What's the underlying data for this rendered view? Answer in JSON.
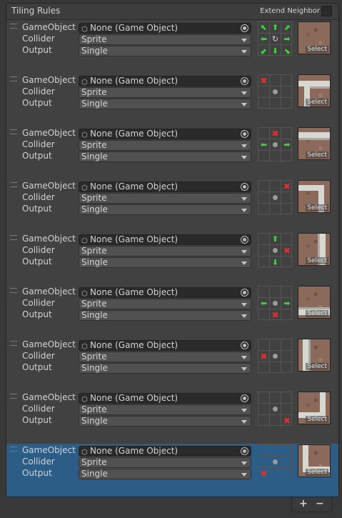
{
  "panel": {
    "title": "Tiling Rules",
    "extend_neighbor_label": "Extend Neighbor"
  },
  "labels": {
    "gameobject": "GameObject",
    "collider": "Collider",
    "output": "Output"
  },
  "rules": [
    {
      "gameobject": "None (Game Object)",
      "collider": "Sprite",
      "output": "Single",
      "sprite_button": "Select",
      "selected": false,
      "neighbors": [
        "arrow-up-left",
        "arrow-up",
        "arrow-up-right",
        "arrow-left",
        "rotate",
        "arrow-right",
        "arrow-down-left",
        "arrow-down",
        "arrow-down-right"
      ]
    },
    {
      "gameobject": "None (Game Object)",
      "collider": "Sprite",
      "output": "Single",
      "sprite_button": "Select",
      "selected": false,
      "neighbors": [
        "x",
        "",
        "",
        "",
        "dot",
        "",
        "",
        "",
        ""
      ]
    },
    {
      "gameobject": "None (Game Object)",
      "collider": "Sprite",
      "output": "Single",
      "sprite_button": "Select",
      "selected": false,
      "neighbors": [
        "",
        "x",
        "",
        "arrow-left",
        "dot",
        "arrow-right",
        "",
        "",
        ""
      ]
    },
    {
      "gameobject": "None (Game Object)",
      "collider": "Sprite",
      "output": "Single",
      "sprite_button": "Select",
      "selected": false,
      "neighbors": [
        "",
        "",
        "x",
        "",
        "dot",
        "",
        "",
        "",
        ""
      ]
    },
    {
      "gameobject": "None (Game Object)",
      "collider": "Sprite",
      "output": "Single",
      "sprite_button": "Select",
      "selected": false,
      "neighbors": [
        "",
        "arrow-up",
        "",
        "",
        "dot",
        "x",
        "",
        "arrow-down",
        ""
      ]
    },
    {
      "gameobject": "None (Game Object)",
      "collider": "Sprite",
      "output": "Single",
      "sprite_button": "Select",
      "selected": false,
      "neighbors": [
        "",
        "",
        "",
        "arrow-left",
        "dot",
        "arrow-right",
        "",
        "x",
        ""
      ]
    },
    {
      "gameobject": "None (Game Object)",
      "collider": "Sprite",
      "output": "Single",
      "sprite_button": "Select",
      "selected": false,
      "neighbors": [
        "",
        "",
        "",
        "x",
        "dot",
        "",
        "",
        "",
        ""
      ]
    },
    {
      "gameobject": "None (Game Object)",
      "collider": "Sprite",
      "output": "Single",
      "sprite_button": "Select",
      "selected": false,
      "neighbors": [
        "",
        "",
        "",
        "",
        "dot",
        "",
        "",
        "",
        "x"
      ]
    },
    {
      "gameobject": "None (Game Object)",
      "collider": "Sprite",
      "output": "Single",
      "sprite_button": "Select",
      "selected": true,
      "neighbors": [
        "",
        "",
        "",
        "",
        "dot",
        "",
        "x",
        "",
        ""
      ]
    }
  ],
  "footer": {
    "add_label": "+",
    "remove_label": "−"
  },
  "colors": {
    "selected_row": "#2c5d87",
    "arrow": "#3ad43a",
    "cross": "#e03030",
    "panel": "#414141"
  }
}
